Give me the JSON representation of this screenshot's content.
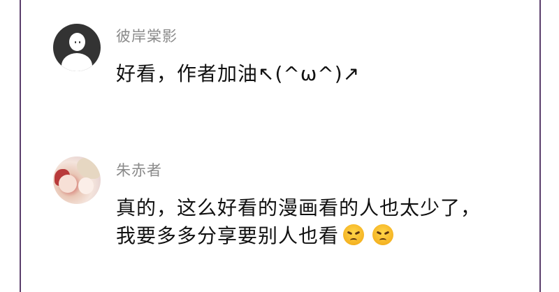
{
  "comments": [
    {
      "username": "彼岸棠影",
      "lines": [
        "好看，作者加油↖(^ω^)↗"
      ]
    },
    {
      "username": "朱赤者",
      "lines": [
        "真的，这么好看的漫画看的人也太少了，",
        "我要多多分享要别人也看"
      ],
      "emojis": [
        "angry-face-icon",
        "angry-face-icon"
      ]
    }
  ],
  "colors": {
    "frame_border": "#5a3d6b",
    "username": "#8a8a8a",
    "text": "#111111"
  }
}
